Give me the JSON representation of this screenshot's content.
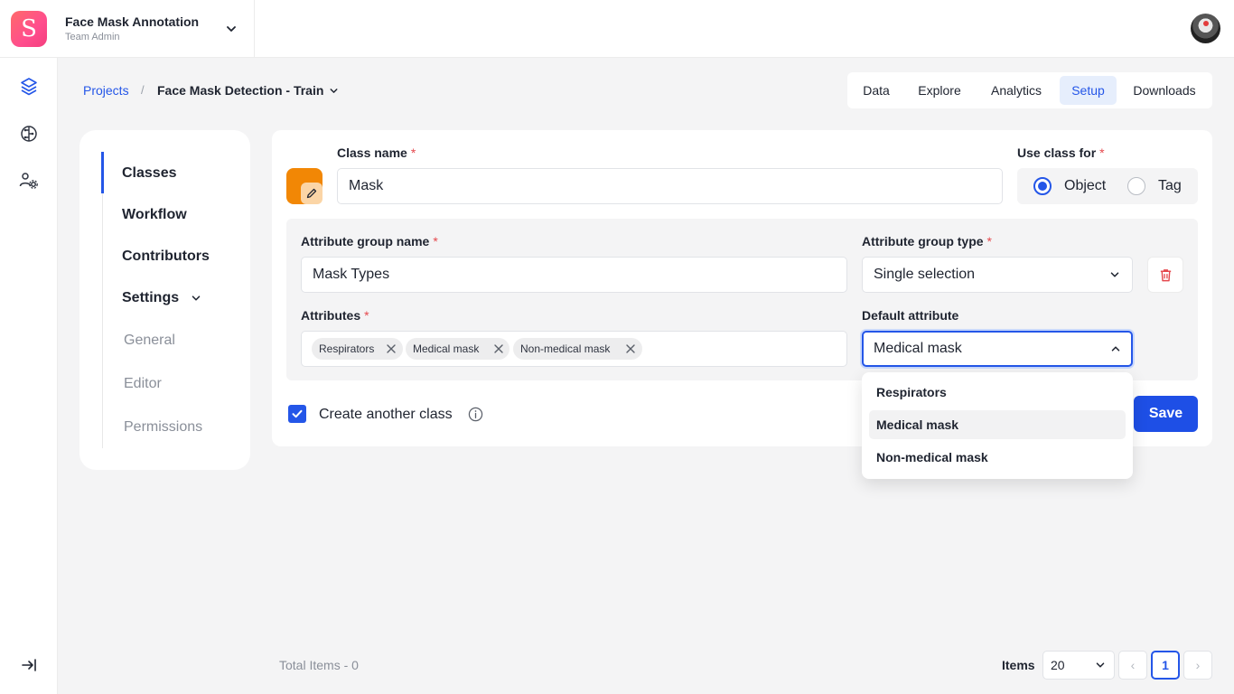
{
  "header": {
    "logo_letter": "S",
    "team_name": "Face Mask Annotation",
    "team_role": "Team Admin"
  },
  "breadcrumb": {
    "projects": "Projects",
    "separator": "/",
    "current": "Face Mask Detection - Train"
  },
  "tabs": [
    {
      "label": "Data",
      "active": false
    },
    {
      "label": "Explore",
      "active": false
    },
    {
      "label": "Analytics",
      "active": false
    },
    {
      "label": "Setup",
      "active": true
    },
    {
      "label": "Downloads",
      "active": false
    }
  ],
  "side_menu": {
    "items": [
      "Classes",
      "Workflow",
      "Contributors",
      "Settings"
    ],
    "sub_items": [
      "General",
      "Editor",
      "Permissions"
    ],
    "active": "Classes"
  },
  "form": {
    "class_name_label": "Class name",
    "class_name_value": "Mask",
    "class_color": "#f28705",
    "use_class_for_label": "Use class for",
    "use_options": [
      "Object",
      "Tag"
    ],
    "use_selected": "Object",
    "attr_group_name_label": "Attribute group name",
    "attr_group_name_value": "Mask Types",
    "attr_group_type_label": "Attribute group type",
    "attr_group_type_value": "Single selection",
    "attributes_label": "Attributes",
    "attributes": [
      "Respirators",
      "Medical mask",
      "Non-medical mask"
    ],
    "default_attr_label": "Default attribute",
    "default_attr_value": "Medical mask",
    "dropdown_options": [
      "Respirators",
      "Medical mask",
      "Non-medical mask"
    ],
    "create_another_label": "Create another class",
    "create_another_checked": true,
    "save_label": "Save",
    "required_mark": "*"
  },
  "footer": {
    "total_items": "Total Items - 0",
    "items_label": "Items",
    "per_page": "20",
    "current_page": "1",
    "prev": "‹",
    "next": "›"
  },
  "colors": {
    "accent": "#2456e8",
    "save": "#1e4fe6",
    "required": "#e5484d",
    "delete": "#e5484d"
  }
}
